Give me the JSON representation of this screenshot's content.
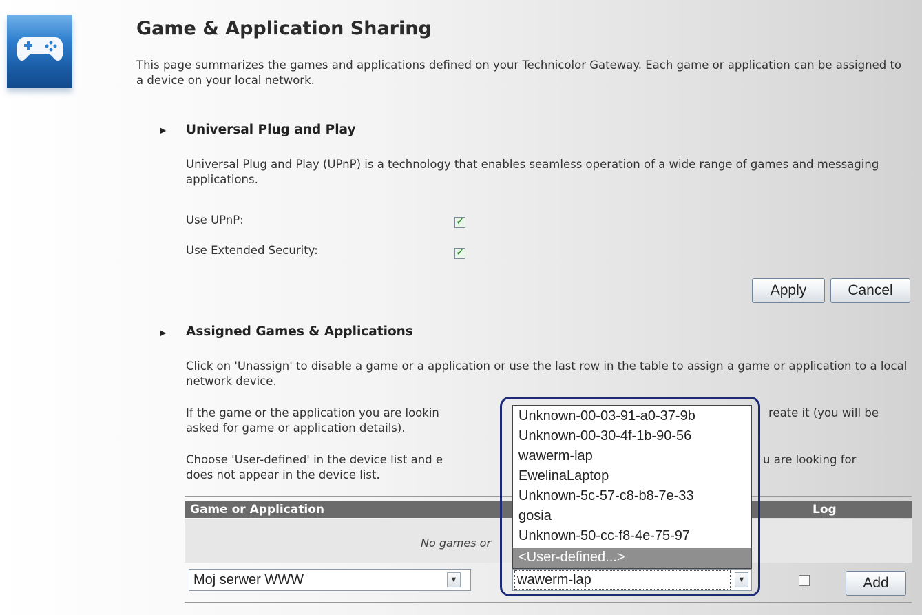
{
  "page": {
    "title": "Game & Application Sharing",
    "intro": "This page summarizes the games and applications defined on your Technicolor Gateway. Each game or application can be assigned to a device on your local network."
  },
  "upnp": {
    "heading": "Universal Plug and Play",
    "description": "Universal Plug and Play (UPnP) is a technology that enables seamless operation of a wide range of games and messaging applications.",
    "use_upnp_label": "Use UPnP:",
    "use_upnp_checked": true,
    "extended_security_label": "Use Extended Security:",
    "extended_security_checked": true,
    "apply_label": "Apply",
    "cancel_label": "Cancel"
  },
  "assigned": {
    "heading": "Assigned Games & Applications",
    "para1": "Click on 'Unassign' to disable a game or a application or use the last row in the table to assign a game or application to a local network device.",
    "para2_line1_start": "If the game or the application you are lookin",
    "para2_line1_end": "reate it (you will be",
    "para2_line2": "asked for game or application details).",
    "para3_line1_start": "Choose 'User-defined' in the device list and e",
    "para3_line1_end": "u are looking for",
    "para3_line2": "does not appear in the device list."
  },
  "table": {
    "col_game": "Game or Application",
    "col_log": "Log",
    "empty_text_visible": "No games or",
    "game_select_value": "Moj serwer WWW",
    "device_select_value": "wawerm-lap",
    "add_label": "Add"
  },
  "device_dropdown": {
    "options": [
      "Unknown-00-03-91-a0-37-9b",
      "Unknown-00-30-4f-1b-90-56",
      "wawerm-lap",
      "EwelinaLaptop",
      "Unknown-5c-57-c8-b8-7e-33",
      "gosia",
      "Unknown-50-cc-f8-4e-75-97",
      "<User-defined...>"
    ],
    "highlighted": "<User-defined...>"
  },
  "colors": {
    "table_header": "#6b6b6b",
    "highlight_border": "#1c2a78",
    "icon_blue": "#2f7fcf",
    "check_green": "#1e8a1e"
  },
  "icons": {
    "app": "gamepad-icon",
    "section_marker": "triangle-right-icon",
    "select_arrow": "chevron-down-icon"
  }
}
